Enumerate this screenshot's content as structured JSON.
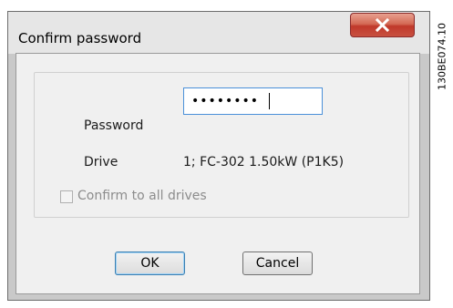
{
  "dialog": {
    "title": "Confirm password",
    "close_icon": "close-x-icon"
  },
  "form": {
    "password_label": "Password",
    "password_value": "••••••••",
    "drive_label": "Drive",
    "drive_value": "1; FC-302 1.50kW (P1K5)",
    "confirm_all_label": "Confirm to all drives",
    "confirm_all_checked": false,
    "confirm_all_enabled": false
  },
  "buttons": {
    "ok_label": "OK",
    "cancel_label": "Cancel"
  },
  "figure_code": "130BE074.10",
  "colors": {
    "close_button": "#c0392b",
    "input_border": "#4a90d9",
    "dialog_background": "#f0f0f0"
  }
}
